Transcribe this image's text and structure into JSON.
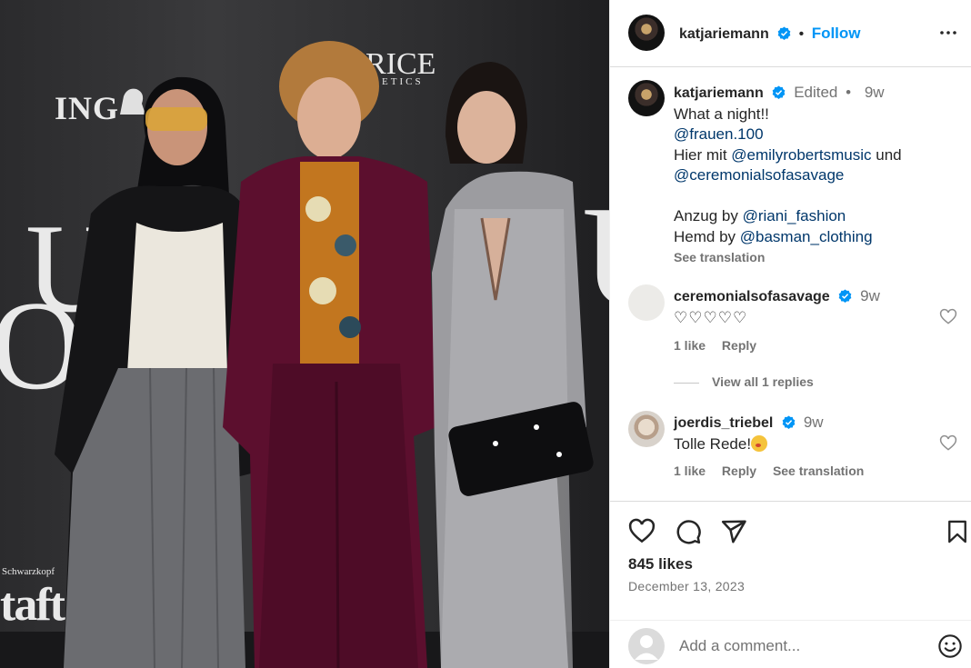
{
  "photo": {
    "backdrop": {
      "ing": "ING",
      "rice": "RICE",
      "cosmetics": "ETICS",
      "schwarzkopf": "Schwarzkopf",
      "taft": "taft",
      "big_left": "UEN",
      "big_left2": "OC",
      "big_right": "U"
    }
  },
  "header": {
    "username": "katjariemann",
    "dot": "•",
    "follow_label": "Follow",
    "more_icon": "more-horizontal-icon"
  },
  "post": {
    "username": "katjariemann",
    "edited": "Edited",
    "dot": "•",
    "time": "9w",
    "caption": {
      "line1": "What a night!!",
      "mention1": "@frauen.100",
      "line3_prefix": "Hier mit ",
      "mention2": "@emilyrobertsmusic",
      "line3_suffix": " und",
      "mention3": "@ceremonialsofasavage",
      "line5_prefix": "Anzug by ",
      "mention4": "@riani_fashion",
      "line6_prefix": "Hemd by ",
      "mention5": "@basman_clothing"
    },
    "see_translation": "See translation"
  },
  "comments": [
    {
      "username": "ceremonialsofasavage",
      "time": "9w",
      "text": "♡♡♡♡♡",
      "likes": "1 like",
      "reply": "Reply",
      "view_replies": "View all 1 replies"
    },
    {
      "username": "joerdis_triebel",
      "time": "9w",
      "text": "Tolle Rede!",
      "likes": "1 like",
      "reply": "Reply",
      "see_translation": "See translation"
    }
  ],
  "actions": {
    "like_icon": "heart-icon",
    "comment_icon": "comment-icon",
    "share_icon": "share-icon",
    "save_icon": "bookmark-icon",
    "likes": "845 likes",
    "date": "December 13, 2023"
  },
  "add_comment": {
    "placeholder": "Add a comment...",
    "emoji_icon": "smiley-icon"
  },
  "colors": {
    "link": "#00376b",
    "follow": "#0095f6",
    "verified": "#0095f6",
    "secondary_text": "#737373"
  }
}
